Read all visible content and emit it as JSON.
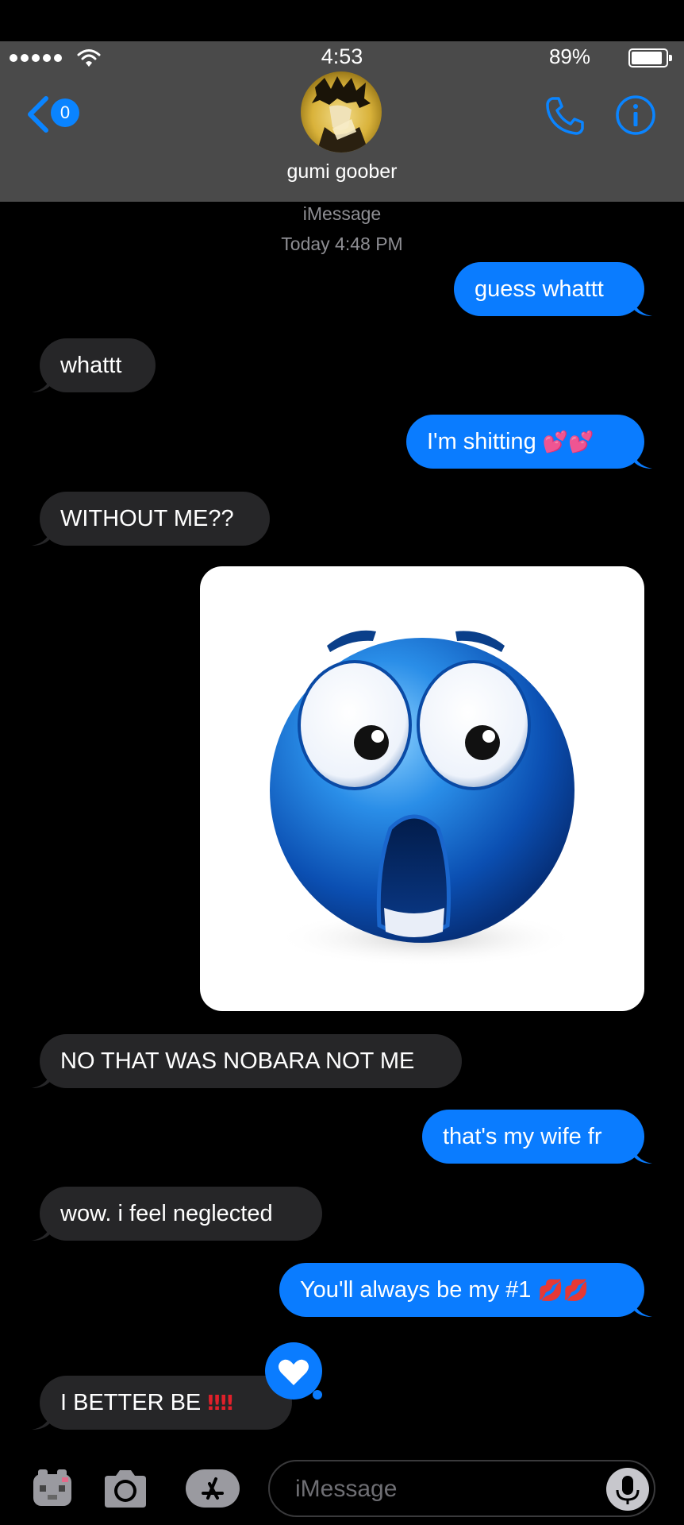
{
  "status_bar": {
    "time": "4:53",
    "battery_percent": "89%",
    "battery_level": 0.89
  },
  "header": {
    "back_badge_count": "0",
    "contact_name": "gumi goober"
  },
  "thread": {
    "service_label": "iMessage",
    "timestamp": "Today 4:48 PM",
    "messages": [
      {
        "direction": "outgoing",
        "text": "guess whattt",
        "emoji": ""
      },
      {
        "direction": "incoming",
        "text": "whattt",
        "emoji": ""
      },
      {
        "direction": "outgoing",
        "text": "I'm shitting ",
        "emoji": "💕💕"
      },
      {
        "direction": "incoming",
        "text": "WITHOUT ME??",
        "emoji": ""
      },
      {
        "direction": "outgoing",
        "type": "image",
        "image_icon": "shocked-blue-face-emoji"
      },
      {
        "direction": "incoming",
        "text": "NO THAT WAS NOBARA NOT ME",
        "emoji": ""
      },
      {
        "direction": "outgoing",
        "text": "that's my wife fr",
        "emoji": ""
      },
      {
        "direction": "incoming",
        "text": "wow. i feel neglected",
        "emoji": ""
      },
      {
        "direction": "outgoing",
        "text": "You'll always be my #1 ",
        "emoji": "💋💋"
      },
      {
        "direction": "incoming",
        "text": "I BETTER BE ",
        "emoji": "‼‼",
        "tapback": "heart-icon"
      }
    ]
  },
  "input_bar": {
    "placeholder": "iMessage"
  },
  "colors": {
    "outgoing_bubble": "#0a7cff",
    "incoming_bubble": "#262628",
    "accent": "#0a84ff",
    "header_bg": "#4a4a4a"
  }
}
